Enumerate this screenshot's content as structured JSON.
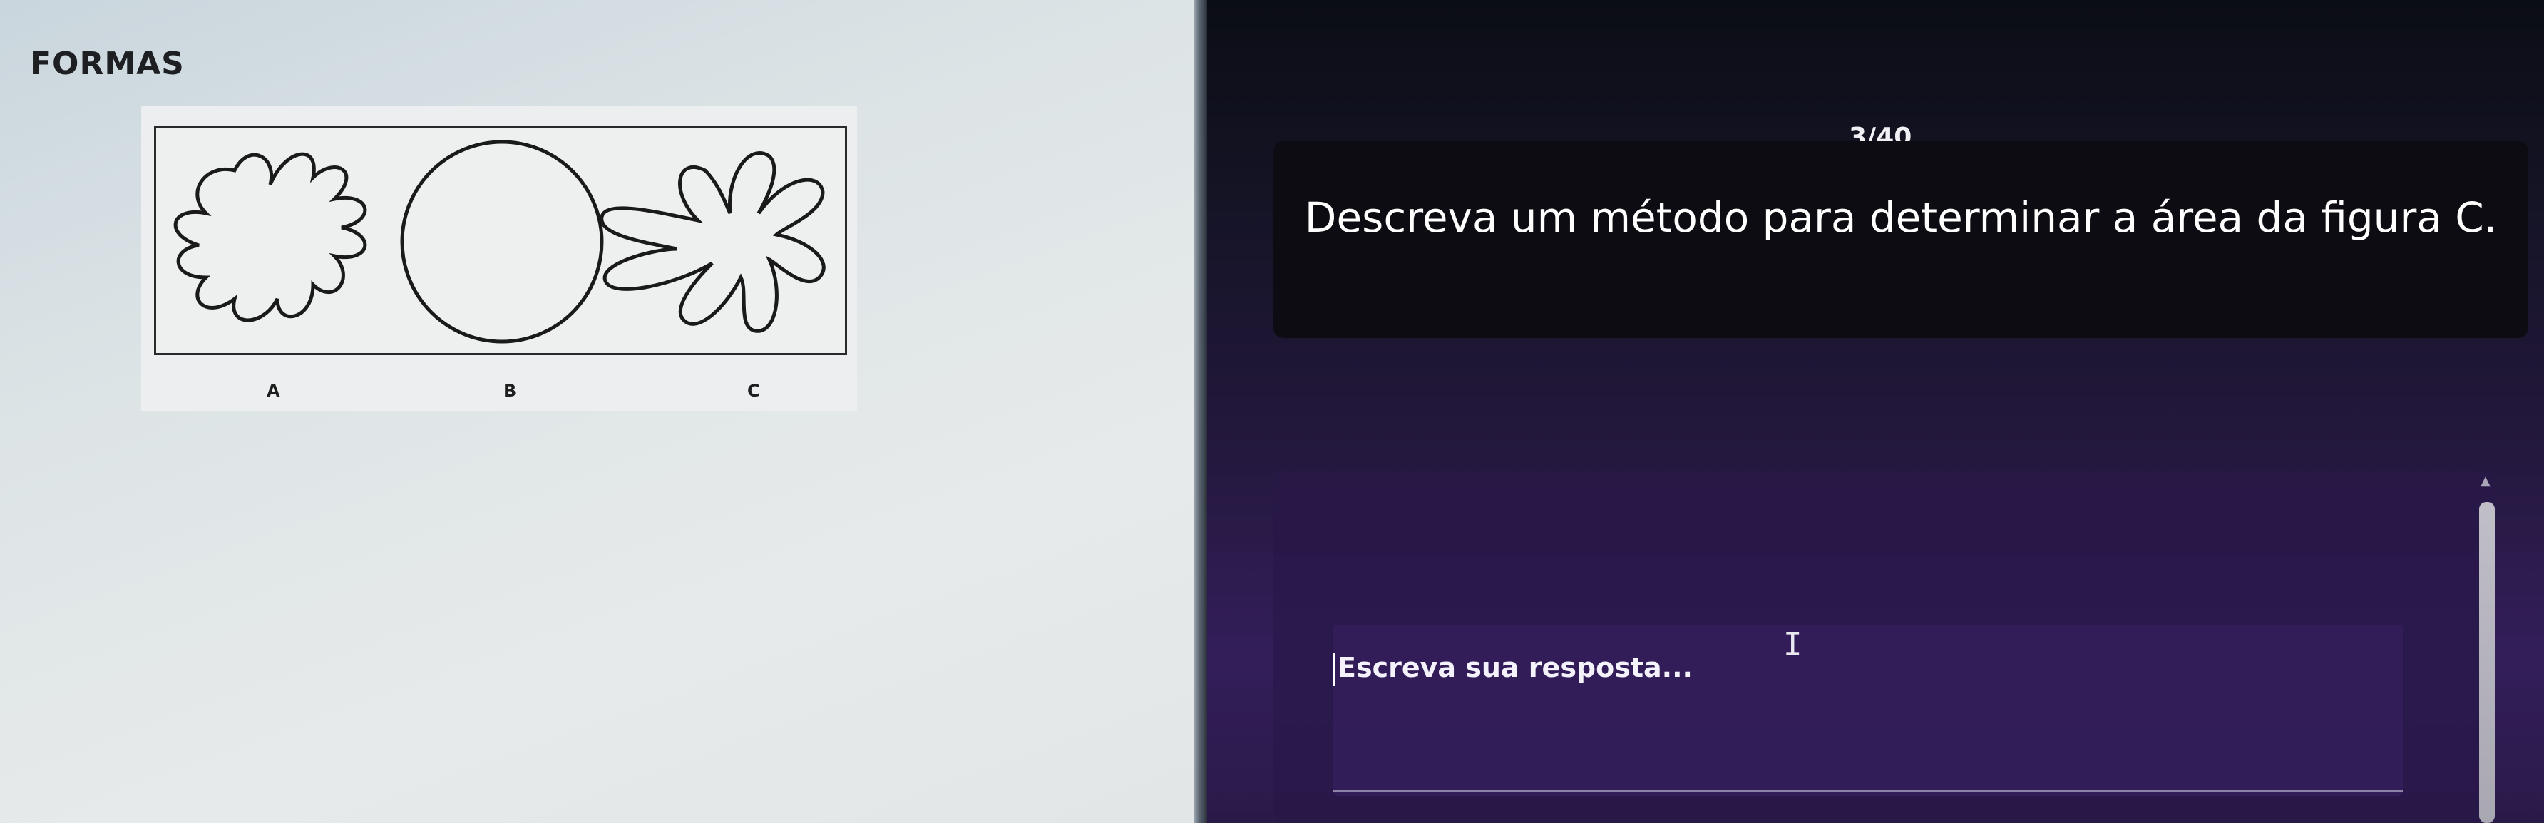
{
  "left_panel": {
    "title": "FORMAS",
    "figure_labels": [
      "A",
      "B",
      "C"
    ]
  },
  "quiz": {
    "counter": "3/40",
    "question": "Descreva um método para determinar a área da figura C.",
    "answer_placeholder": "Escreva sua resposta..."
  },
  "colors": {
    "left_bg": "#dde4e6",
    "question_card": "#0c0c12",
    "panel_purple": "#331e5a"
  }
}
